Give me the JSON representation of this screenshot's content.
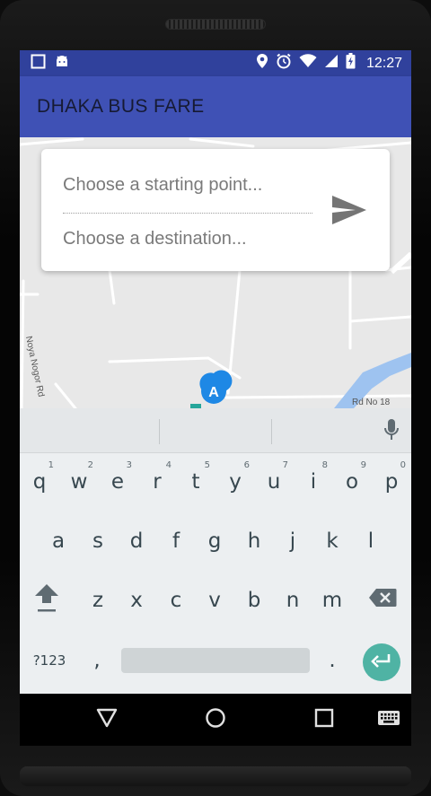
{
  "status_bar": {
    "time": "12:27",
    "icons": [
      "notification-square-icon",
      "android-robot-icon",
      "location-pin-icon",
      "alarm-icon",
      "wifi-icon",
      "cell-signal-icon",
      "battery-charging-icon"
    ]
  },
  "app_bar": {
    "title": "DHAKA BUS FARE"
  },
  "search": {
    "start_placeholder": "Choose a starting point...",
    "start_value": "",
    "destination_placeholder": "Choose a destination...",
    "destination_value": "",
    "send_icon": "send-icon"
  },
  "map": {
    "road_labels": [
      "Noya Nogor Rd",
      "Rd No 18"
    ],
    "marker_label": "A",
    "colors": {
      "water": "#9ec3f0",
      "road": "#ffffff",
      "marker": "#1e88e5"
    }
  },
  "keyboard": {
    "row1": [
      {
        "key": "q",
        "hint": "1"
      },
      {
        "key": "w",
        "hint": "2"
      },
      {
        "key": "e",
        "hint": "3"
      },
      {
        "key": "r",
        "hint": "4"
      },
      {
        "key": "t",
        "hint": "5"
      },
      {
        "key": "y",
        "hint": "6"
      },
      {
        "key": "u",
        "hint": "7"
      },
      {
        "key": "i",
        "hint": "8"
      },
      {
        "key": "o",
        "hint": "9"
      },
      {
        "key": "p",
        "hint": "0"
      }
    ],
    "row2": [
      "a",
      "s",
      "d",
      "f",
      "g",
      "h",
      "j",
      "k",
      "l"
    ],
    "row3": [
      "z",
      "x",
      "c",
      "v",
      "b",
      "n",
      "m"
    ],
    "symbols_label": "?123",
    "comma": ",",
    "period": ".",
    "colors": {
      "enter": "#4fb3a4",
      "background": "#eceff1"
    }
  },
  "nav": {
    "icons": [
      "back-icon",
      "home-icon",
      "recents-icon",
      "keyboard-icon"
    ]
  }
}
